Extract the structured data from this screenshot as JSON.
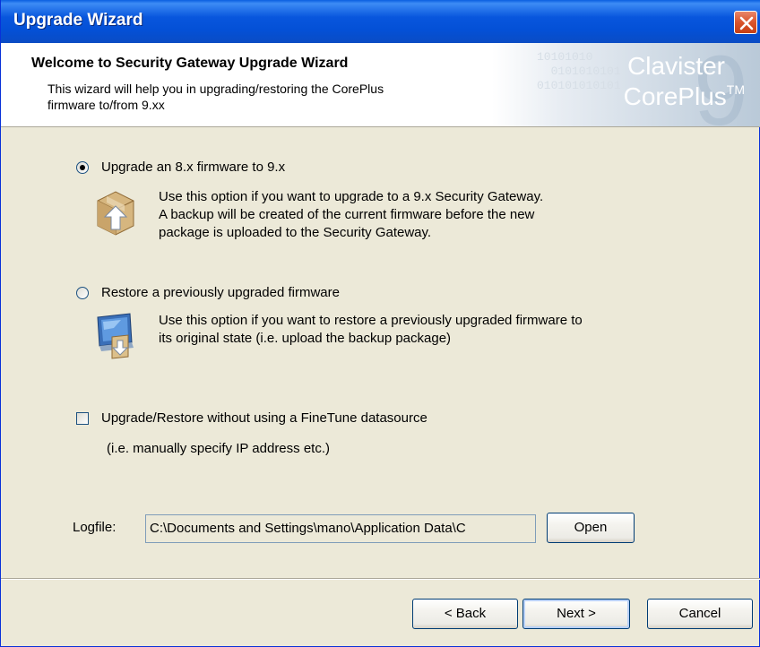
{
  "window": {
    "title": "Upgrade Wizard"
  },
  "header": {
    "title": "Welcome to Security Gateway Upgrade Wizard",
    "subtitle_line1": "This wizard will help you in upgrading/restoring the CorePlus",
    "subtitle_line2": "firmware to/from 9.xx",
    "brand_line1": "Clavister",
    "brand_line2": "CorePlus",
    "brand_tm": "TM",
    "brand_numeral": "9",
    "binary_pattern": "10101010\n  0101010101\n010101010101"
  },
  "options": {
    "upgrade": {
      "label": "Upgrade an 8.x firmware to 9.x",
      "selected": true,
      "desc_1": "Use this option if you want to upgrade to a 9.x Security Gateway.",
      "desc_2": "A backup will be created of the current firmware before the new",
      "desc_3": "package is uploaded to the Security Gateway.",
      "icon": "package-upload-icon"
    },
    "restore": {
      "label": "Restore a previously upgraded firmware",
      "selected": false,
      "desc_1": "Use this option if you want to restore a previously upgraded firmware to",
      "desc_2": "its original state (i.e. upload the backup package)",
      "icon": "computer-restore-icon"
    },
    "no_datasource": {
      "label": "Upgrade/Restore without using a FineTune datasource",
      "checked": false,
      "note": "(i.e. manually specify IP address etc.)"
    }
  },
  "logfile": {
    "label": "Logfile:",
    "value": "C:\\Documents and Settings\\mano\\Application Data\\C",
    "open_label": "Open"
  },
  "footer": {
    "back_label": "< Back",
    "next_label": "Next >",
    "cancel_label": "Cancel"
  },
  "colors": {
    "titlebar": "#0856dd",
    "dialog_bg": "#ece9d8",
    "close_button": "#d9542c"
  }
}
